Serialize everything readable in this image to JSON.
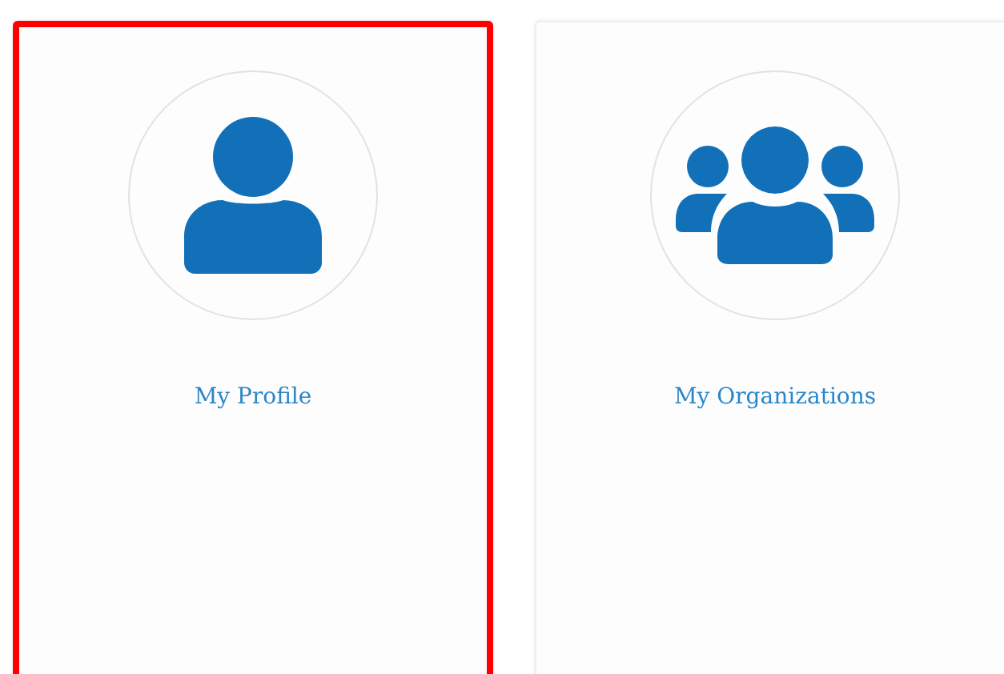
{
  "cards": [
    {
      "label": "My Profile",
      "kind": "person",
      "selected": true
    },
    {
      "label": "My Organizations",
      "kind": "group",
      "selected": false
    }
  ]
}
